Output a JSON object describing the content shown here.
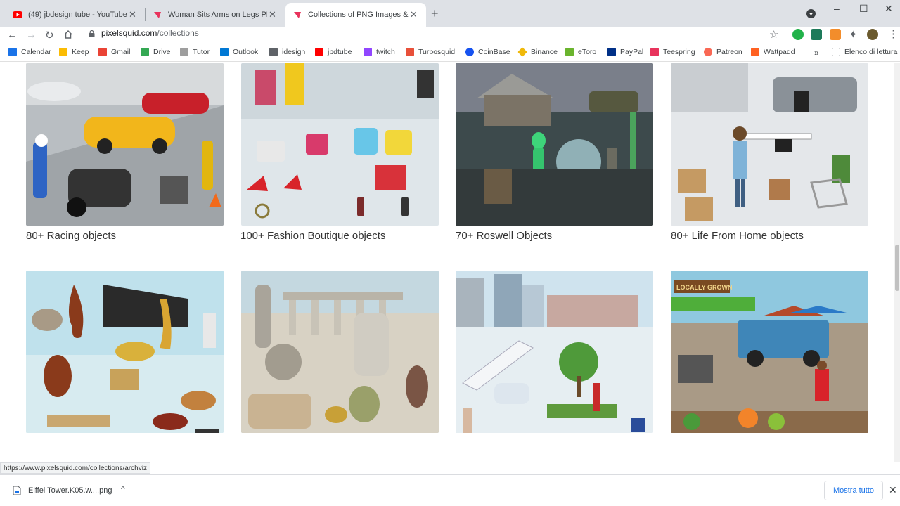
{
  "tabs": [
    {
      "title": "(49) jbdesign tube - YouTube",
      "favicon": "youtube-icon",
      "color": "#ff0000"
    },
    {
      "title": "Woman Sits Arms on Legs PNG I",
      "favicon": "pixelsquid-icon",
      "color": "#e8335c"
    },
    {
      "title": "Collections of PNG Images & PSI",
      "favicon": "pixelsquid-icon",
      "color": "#e8335c"
    }
  ],
  "address": {
    "host": "pixelsquid.com",
    "path": "/collections"
  },
  "bookmarks": [
    {
      "label": "Calendar",
      "color": "#1a73e8"
    },
    {
      "label": "Keep",
      "color": "#fbbc04"
    },
    {
      "label": "Gmail",
      "color": "#ea4335"
    },
    {
      "label": "Drive",
      "color": "#34a853"
    },
    {
      "label": "Tutor",
      "color": "#9e9e9e"
    },
    {
      "label": "Outlook",
      "color": "#0078d4"
    },
    {
      "label": "idesign",
      "color": "#5f6368"
    },
    {
      "label": "jbdtube",
      "color": "#ff0000"
    },
    {
      "label": "twitch",
      "color": "#9146ff"
    },
    {
      "label": "Turbosquid",
      "color": "#e8503a"
    },
    {
      "label": "CoinBase",
      "color": "#1652f0"
    },
    {
      "label": "Binance",
      "color": "#f0b90b"
    },
    {
      "label": "eToro",
      "color": "#6ab42d"
    },
    {
      "label": "PayPal",
      "color": "#003087"
    },
    {
      "label": "Teespring",
      "color": "#e8335c"
    },
    {
      "label": "Patreon",
      "color": "#f96854"
    },
    {
      "label": "Wattpadd",
      "color": "#ff6122"
    }
  ],
  "bookmarks_more": "»",
  "reading_list": "Elenco di lettura",
  "collections": [
    {
      "label": "80+ Racing objects",
      "theme": "racing"
    },
    {
      "label": "100+ Fashion Boutique objects",
      "theme": "fashion"
    },
    {
      "label": "70+ Roswell Objects",
      "theme": "roswell"
    },
    {
      "label": "80+ Life From Home objects",
      "theme": "home"
    },
    {
      "label": "",
      "theme": "music"
    },
    {
      "label": "",
      "theme": "ancient"
    },
    {
      "label": "",
      "theme": "city"
    },
    {
      "label": "",
      "theme": "market"
    }
  ],
  "market_sign": "LOCALLY GROWN",
  "status_url": "https://www.pixelsquid.com/collections/archviz",
  "download": {
    "file": "Eiffel Tower.K05.w....png",
    "show_all": "Mostra tutto"
  }
}
